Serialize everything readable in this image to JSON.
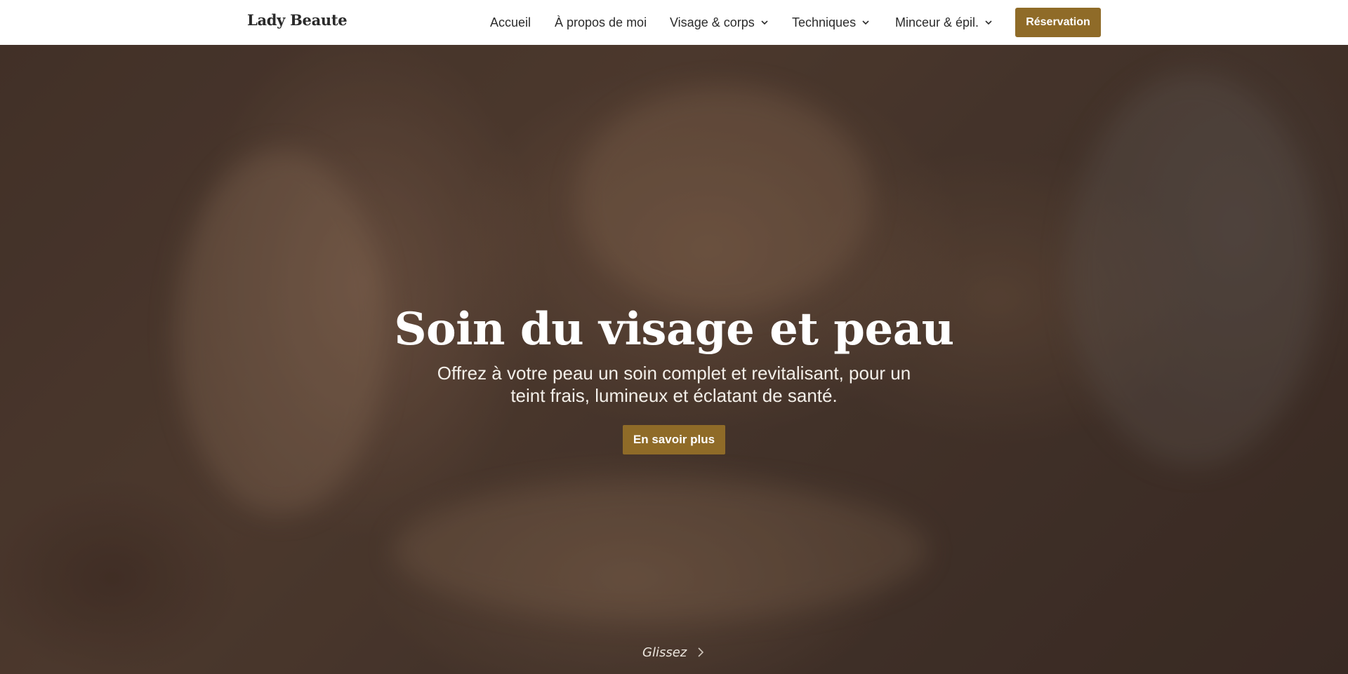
{
  "header": {
    "logo": "Lady Beaute",
    "nav": [
      {
        "label": "Accueil",
        "has_dropdown": false
      },
      {
        "label": "À propos de moi",
        "has_dropdown": false
      },
      {
        "label": "Visage & corps",
        "has_dropdown": true,
        "icon": "chevron-down-icon"
      },
      {
        "label": "Techniques",
        "has_dropdown": true,
        "icon": "chevron-down-icon"
      },
      {
        "label": "Minceur & épil.",
        "has_dropdown": true,
        "icon": "chevron-down-icon"
      }
    ],
    "cta_label": "Réservation"
  },
  "hero": {
    "title": "Soin du visage et peau",
    "subtitle": "Offrez à votre peau un soin complet et revitalisant, pour un teint frais, lumineux et éclatant de santé.",
    "button_label": "En savoir plus",
    "scroll_label": "Glissez",
    "scroll_icon": "chevron-right-icon"
  },
  "colors": {
    "accent": "#8f6b28",
    "header_bg": "#ffffff",
    "text_dark": "#2b2b2b",
    "hero_text": "#ffffff"
  }
}
